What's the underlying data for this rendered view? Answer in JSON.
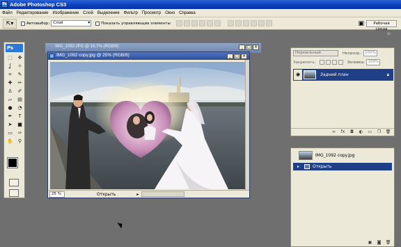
{
  "app": {
    "title": "Adobe Photoshop CS3",
    "logo": "Ps"
  },
  "menu": [
    "Файл",
    "Редактирование",
    "Изображение",
    "Слой",
    "Выделение",
    "Фильтр",
    "Просмотр",
    "Окно",
    "Справка"
  ],
  "options": {
    "autoselect_label": "Автовыбор:",
    "autoselect_value": "Слой",
    "show_controls_label": "Показать управляющие элементы",
    "workspace_label": "Рабочая среда"
  },
  "documents": {
    "back_title": "IMG_1092.JPG @ 16,7% (RGB/8)",
    "front_title": "IMG_1092 copy.jpg @ 25% (RGB/8)",
    "zoom": "25 %",
    "status": "Открыть"
  },
  "layers_panel": {
    "blend_mode": "Нормальный",
    "opacity_label": "Непрозр.:",
    "opacity_value": "100%",
    "lock_label": "Закрепить:",
    "fill_label": "Заливка:",
    "fill_value": "100%",
    "layer_name": "Задний план"
  },
  "history_panel": {
    "snapshot_name": "IMG_1092 copy.jpg",
    "step_name": "Открыть"
  },
  "colors": {
    "title_blue": "#0a3fb8",
    "panel_bg": "#ece9d8",
    "workspace_gray": "#6f6f6f",
    "selection_blue": "#1f3f86"
  }
}
